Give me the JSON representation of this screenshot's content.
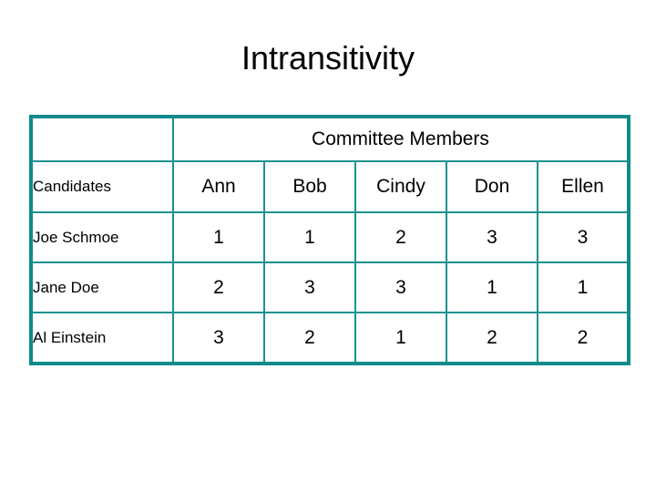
{
  "slide": {
    "title": "Intransitivity",
    "background_color": "#ffffff",
    "text_color": "#000000"
  },
  "table": {
    "border_color": "#0f8b8b",
    "inner_border_color": "#1a9291",
    "corner_blank": "",
    "group_header": "Committee Members",
    "row_label_header": "Candidates",
    "column_headers": [
      "Ann",
      "Bob",
      "Cindy",
      "Don",
      "Ellen"
    ],
    "rows": [
      {
        "label": "Joe Schmoe",
        "values": [
          "1",
          "1",
          "2",
          "3",
          "3"
        ]
      },
      {
        "label": "Jane Doe",
        "values": [
          "2",
          "3",
          "3",
          "1",
          "1"
        ]
      },
      {
        "label": "Al Einstein",
        "values": [
          "3",
          "2",
          "1",
          "2",
          "2"
        ]
      }
    ]
  }
}
